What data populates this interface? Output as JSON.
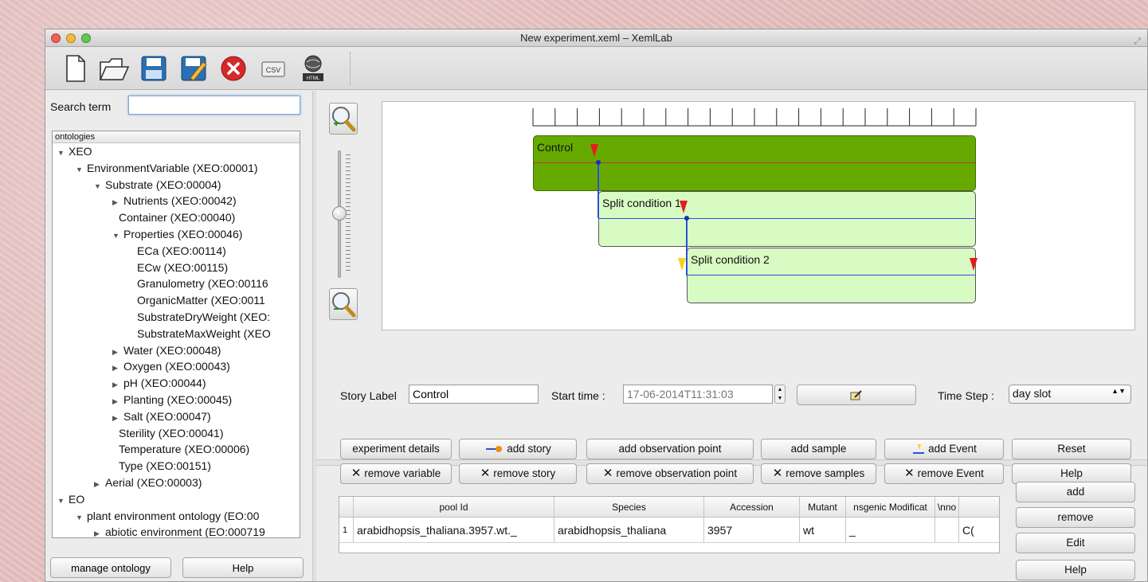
{
  "window": {
    "title": "New experiment.xeml – XemlLab"
  },
  "toolbar": {
    "buttons": [
      {
        "icon": "new-file-icon"
      },
      {
        "icon": "open-folder-icon"
      },
      {
        "icon": "save-icon"
      },
      {
        "icon": "save-as-icon"
      },
      {
        "icon": "close-icon"
      },
      {
        "icon": "csv-icon",
        "label": "CSV"
      },
      {
        "icon": "html-export-icon",
        "label": "HTML"
      }
    ]
  },
  "left_panel": {
    "search_label": "Search term",
    "search_value": "",
    "tree_header": "ontologies",
    "tree": [
      {
        "indent": 0,
        "toggle": "open",
        "label": "XEO"
      },
      {
        "indent": 1,
        "toggle": "open",
        "label": "EnvironmentVariable (XEO:00001)"
      },
      {
        "indent": 2,
        "toggle": "open",
        "label": "Substrate (XEO:00004)"
      },
      {
        "indent": 3,
        "toggle": "closed",
        "label": "Nutrients (XEO:00042)"
      },
      {
        "indent": 3,
        "toggle": "none",
        "label": "Container (XEO:00040)"
      },
      {
        "indent": 3,
        "toggle": "open",
        "label": "Properties (XEO:00046)"
      },
      {
        "indent": 4,
        "toggle": "none",
        "label": "ECa (XEO:00114)"
      },
      {
        "indent": 4,
        "toggle": "none",
        "label": "ECw (XEO:00115)"
      },
      {
        "indent": 4,
        "toggle": "none",
        "label": "Granulometry (XEO:00116"
      },
      {
        "indent": 4,
        "toggle": "none",
        "label": "OrganicMatter (XEO:0011"
      },
      {
        "indent": 4,
        "toggle": "none",
        "label": "SubstrateDryWeight (XEO:"
      },
      {
        "indent": 4,
        "toggle": "none",
        "label": "SubstrateMaxWeight (XEO"
      },
      {
        "indent": 3,
        "toggle": "closed",
        "label": "Water (XEO:00048)"
      },
      {
        "indent": 3,
        "toggle": "closed",
        "label": "Oxygen (XEO:00043)"
      },
      {
        "indent": 3,
        "toggle": "closed",
        "label": "pH (XEO:00044)"
      },
      {
        "indent": 3,
        "toggle": "closed",
        "label": "Planting (XEO:00045)"
      },
      {
        "indent": 3,
        "toggle": "closed",
        "label": "Salt (XEO:00047)"
      },
      {
        "indent": 3,
        "toggle": "none",
        "label": "Sterility (XEO:00041)"
      },
      {
        "indent": 3,
        "toggle": "none",
        "label": "Temperature (XEO:00006)"
      },
      {
        "indent": 3,
        "toggle": "none",
        "label": "Type (XEO:00151)"
      },
      {
        "indent": 2,
        "toggle": "closed",
        "label": "Aerial (XEO:00003)"
      },
      {
        "indent": 0,
        "toggle": "open",
        "label": "EO"
      },
      {
        "indent": 1,
        "toggle": "open",
        "label": "plant environment ontology (EO:00"
      },
      {
        "indent": 2,
        "toggle": "closed",
        "label": "abiotic environment (EO:000719"
      }
    ],
    "manage_label": "manage ontology",
    "help_label": "Help"
  },
  "timeline": {
    "stories": [
      {
        "label": "Control"
      },
      {
        "label": "Split condition 1"
      },
      {
        "label": "Split condition 2"
      }
    ]
  },
  "controls": {
    "story_label_text": "Story Label",
    "story_label_value": "Control",
    "start_time_text": "Start time :",
    "start_time_value": "17-06-2014T11:31:03",
    "time_step_text": "Time Step :",
    "time_step_value": "day slot"
  },
  "actions": {
    "row1": [
      "experiment details",
      "add story",
      "add observation point",
      "add sample",
      "add Event",
      "Reset"
    ],
    "row2": [
      "remove variable",
      "remove story",
      "remove observation point",
      "remove samples",
      "remove Event",
      "Help"
    ]
  },
  "table": {
    "columns": [
      "pool Id",
      "Species",
      "Accession",
      "Mutant",
      "nsgenic Modificat",
      "\\nno"
    ],
    "rows": [
      {
        "index": "1",
        "cells": [
          "arabidhopsis_thaliana.3957.wt._",
          "arabidhopsis_thaliana",
          "3957",
          "wt",
          "_",
          "",
          "C("
        ]
      }
    ]
  },
  "side_buttons": [
    "add",
    "remove",
    "Edit",
    "Help"
  ],
  "colors": {
    "control_fill": "#66aa00",
    "split_fill": "#d8fbc4",
    "connector": "#2a52d8",
    "split_red_line": "#b83b3b"
  }
}
